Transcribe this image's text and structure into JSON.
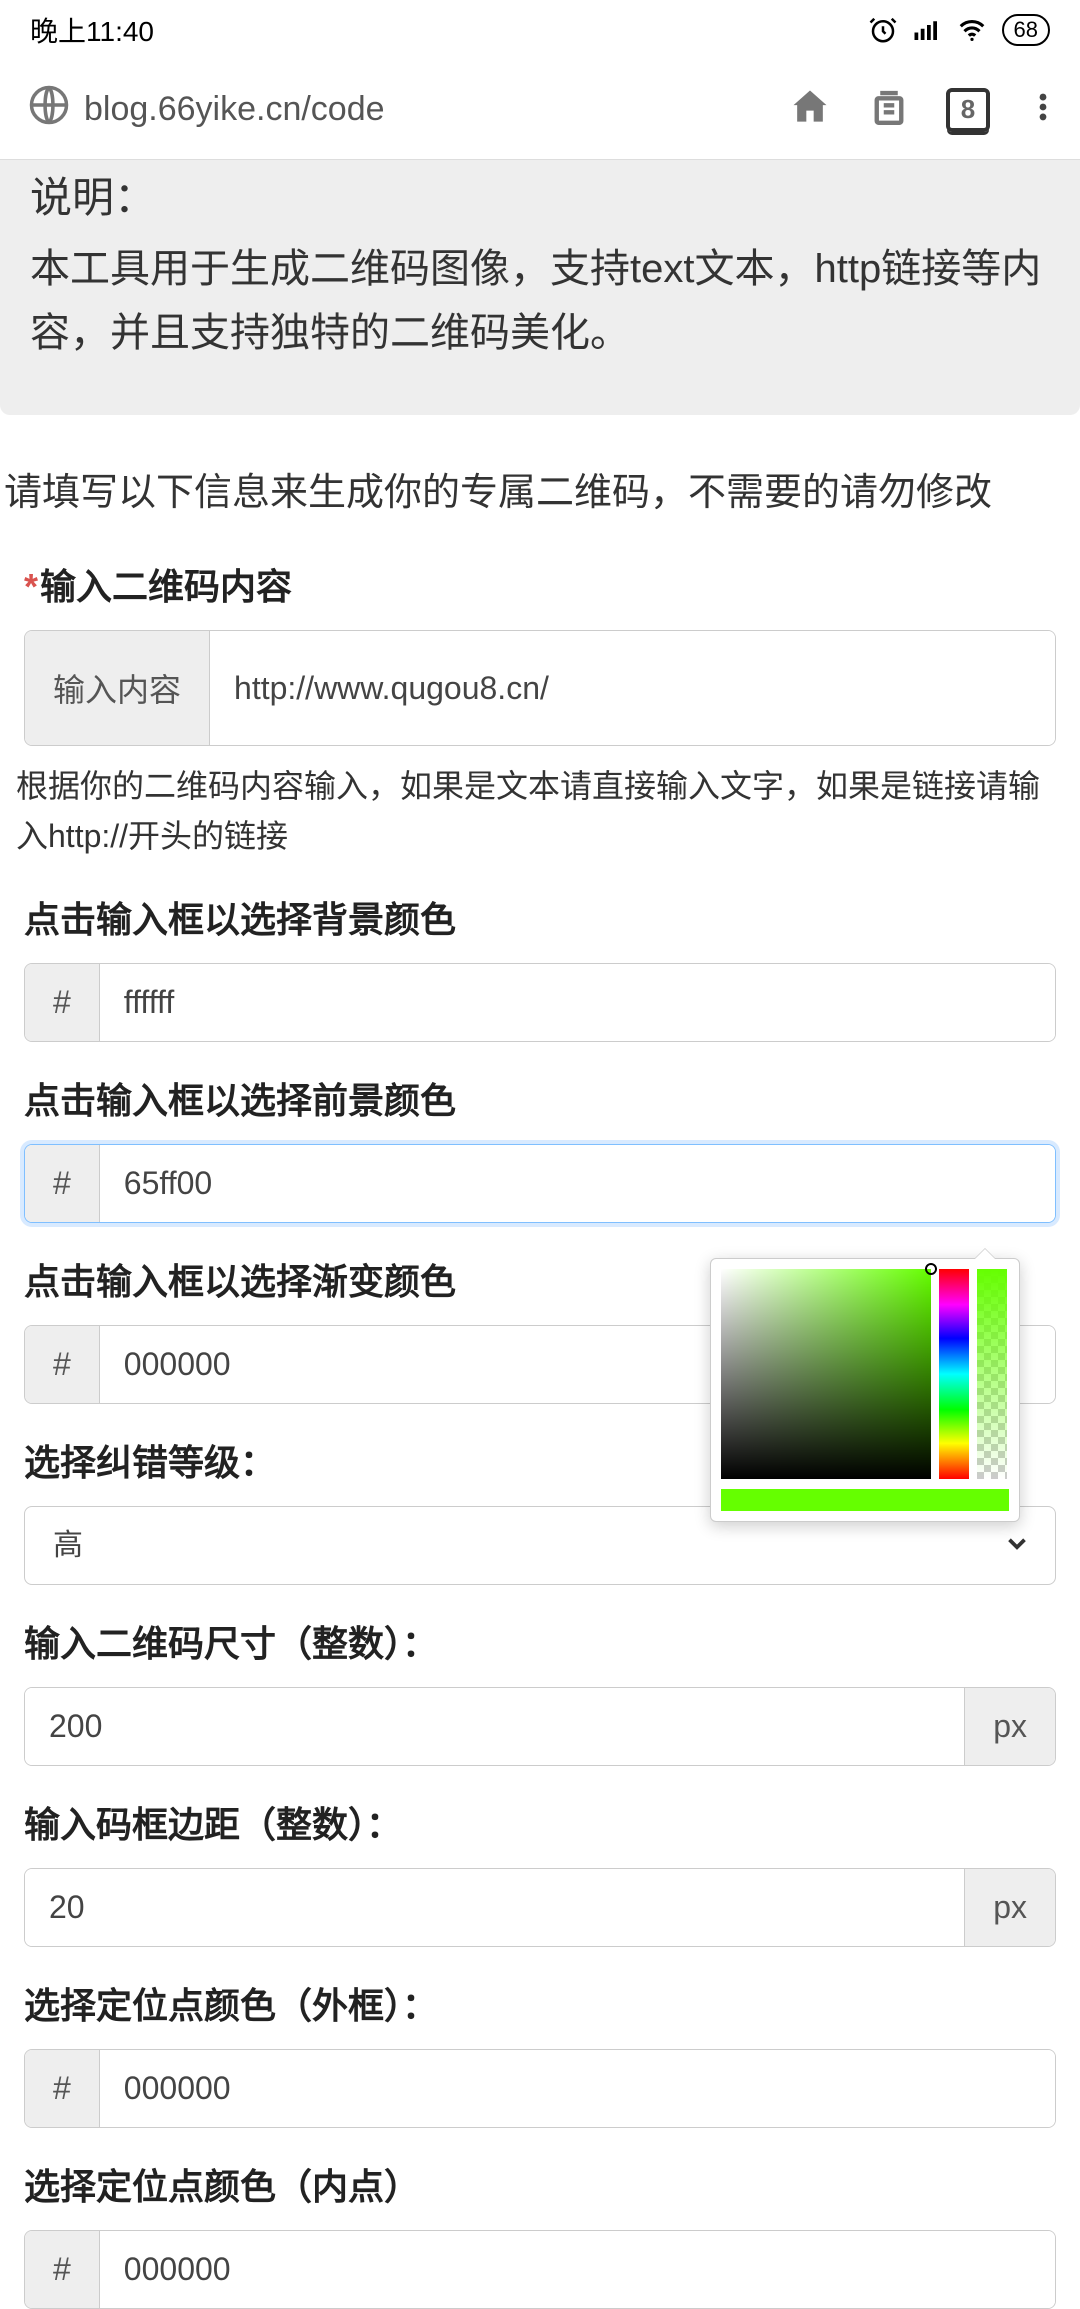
{
  "status": {
    "time": "晚上11:40",
    "battery": "68"
  },
  "browser": {
    "url": "blog.66yike.cn/code",
    "tab_count": "8"
  },
  "notice": {
    "title": "说明：",
    "body": "本工具用于生成二维码图像，支持text文本，http链接等内容，并且支持独特的二维码美化。"
  },
  "intro": "请填写以下信息来生成你的专属二维码，不需要的请勿修改",
  "fields": {
    "content": {
      "label": "输入二维码内容",
      "addon": "输入内容",
      "value": "http://www.qugou8.cn/",
      "help": "根据你的二维码内容输入，如果是文本请直接输入文字，如果是链接请输入http://开头的链接"
    },
    "bgcolor": {
      "label": "点击输入框以选择背景颜色",
      "addon": "#",
      "value": "ffffff"
    },
    "fgcolor": {
      "label": "点击输入框以选择前景颜色",
      "addon": "#",
      "value": "65ff00"
    },
    "gradcolor": {
      "label": "点击输入框以选择渐变颜色",
      "addon": "#",
      "value": "000000"
    },
    "eclevel": {
      "label": "选择纠错等级：",
      "value": "高"
    },
    "size": {
      "label": "输入二维码尺寸（整数）：",
      "value": "200",
      "addon": "px"
    },
    "margin": {
      "label": "输入码框边距（整数）：",
      "value": "20",
      "addon": "px"
    },
    "ptcolor_out": {
      "label": "选择定位点颜色（外框）：",
      "addon": "#",
      "value": "000000"
    },
    "ptcolor_in": {
      "label": "选择定位点颜色（内点）",
      "addon": "#",
      "value": "000000"
    }
  },
  "colorpicker": {
    "current": "#65ff00"
  }
}
